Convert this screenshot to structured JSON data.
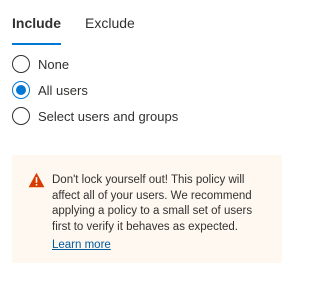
{
  "tabs": [
    {
      "label": "Include",
      "active": true
    },
    {
      "label": "Exclude",
      "active": false
    }
  ],
  "options": [
    {
      "label": "None",
      "selected": false
    },
    {
      "label": "All users",
      "selected": true
    },
    {
      "label": "Select users and groups",
      "selected": false
    }
  ],
  "warning": {
    "icon": "warning-icon",
    "text": "Don't lock yourself out! This policy will affect all of your users. We recommend applying a policy to a small set of users first to verify it behaves as expected.",
    "link": "Learn more"
  },
  "colors": {
    "accent": "#0078d4",
    "warning_icon": "#d83b01",
    "warning_background": "#fff8f1",
    "link": "#005a9e"
  }
}
